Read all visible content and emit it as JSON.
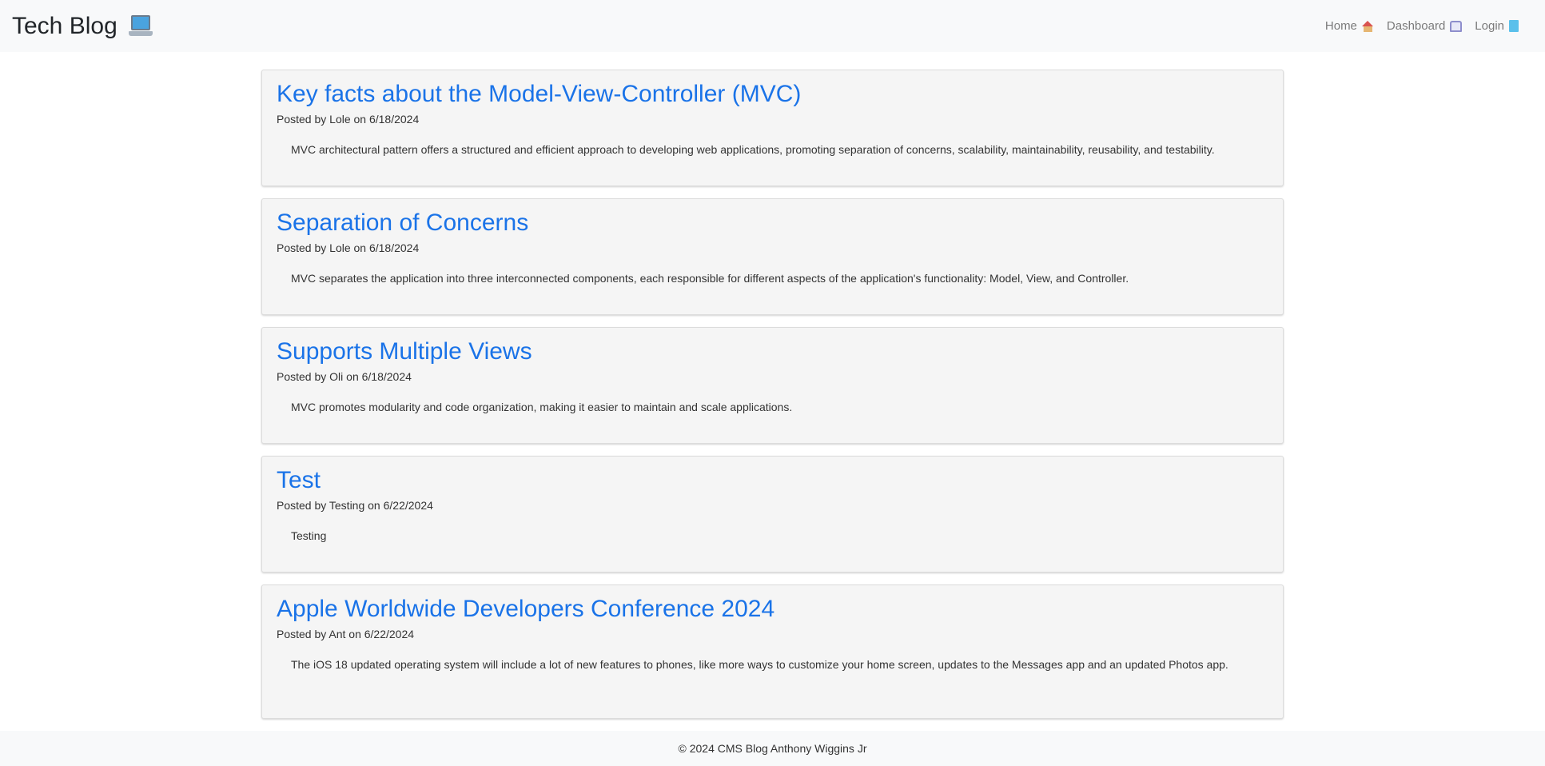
{
  "header": {
    "brand": "Tech Blog",
    "brand_icon": "laptop-icon",
    "nav": [
      {
        "label": "Home",
        "icon": "house-icon"
      },
      {
        "label": "Dashboard",
        "icon": "mailbox-icon"
      },
      {
        "label": "Login",
        "icon": "book-icon"
      }
    ]
  },
  "posts": [
    {
      "title": "Key facts about the Model-View-Controller (MVC)",
      "meta": "Posted by Lole on 6/18/2024",
      "body": "MVC architectural pattern offers a structured and efficient approach to developing web applications, promoting separation of concerns, scalability, maintainability, reusability, and testability."
    },
    {
      "title": "Separation of Concerns",
      "meta": "Posted by Lole on 6/18/2024",
      "body": "MVC separates the application into three interconnected components, each responsible for different aspects of the application's functionality: Model, View, and Controller."
    },
    {
      "title": "Supports Multiple Views",
      "meta": "Posted by Oli on 6/18/2024",
      "body": "MVC promotes modularity and code organization, making it easier to maintain and scale applications."
    },
    {
      "title": "Test",
      "meta": "Posted by Testing on 6/22/2024",
      "body": "Testing"
    },
    {
      "title": "Apple Worldwide Developers Conference 2024",
      "meta": "Posted by Ant on 6/22/2024",
      "body": "The iOS 18 updated operating system will include a lot of new features to phones, like more ways to customize your home screen, updates to the Messages app and an updated Photos app."
    }
  ],
  "footer": {
    "text": "© 2024 CMS Blog Anthony Wiggins Jr"
  },
  "colors": {
    "link": "#1a73e8",
    "nav_bg": "#f8f9fa",
    "card_bg": "#f5f5f5"
  }
}
